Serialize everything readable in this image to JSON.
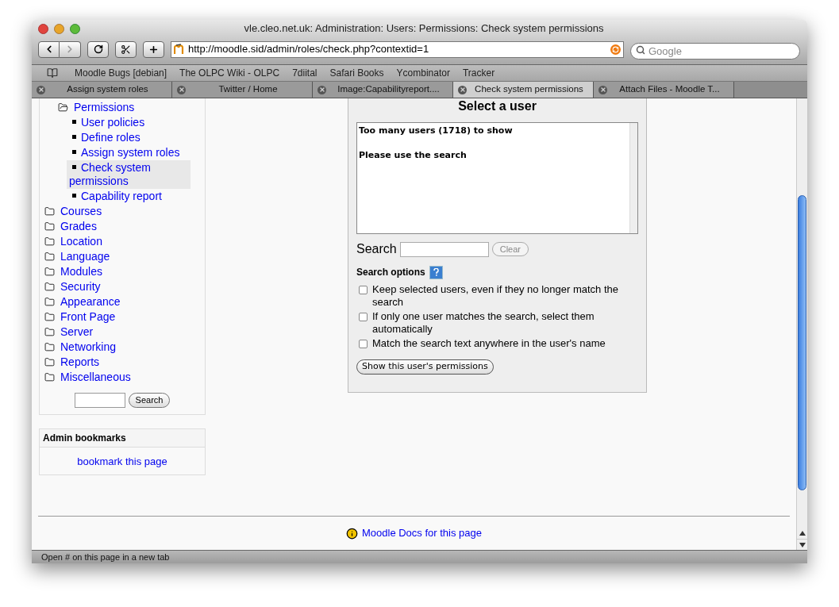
{
  "window": {
    "title": "vle.cleo.net.uk: Administration: Users: Permissions: Check system permissions"
  },
  "toolbar": {
    "url": "http://moodle.sid/admin/roles/check.php?contextid=1",
    "search_placeholder": "Google"
  },
  "bookmarks": [
    "Moodle Bugs [debian]",
    "The OLPC Wiki - OLPC",
    "7diital",
    "Safari Books",
    "Ycombinator",
    "Tracker"
  ],
  "tabs": [
    {
      "label": "Assign system roles",
      "selected": false
    },
    {
      "label": "Twitter / Home",
      "selected": false
    },
    {
      "label": "Image:Capabilityreport....",
      "selected": false
    },
    {
      "label": "Check system permissions",
      "selected": true
    },
    {
      "label": "Attach Files - Moodle T...",
      "selected": false
    }
  ],
  "sidebar": {
    "tree": [
      {
        "label": "Permissions",
        "expanded": true,
        "children": [
          {
            "label": "User policies",
            "selected": false
          },
          {
            "label": "Define roles",
            "selected": false
          },
          {
            "label": "Assign system roles",
            "selected": false
          },
          {
            "label": "Check system permissions",
            "selected": true
          },
          {
            "label": "Capability report",
            "selected": false
          }
        ]
      },
      {
        "label": "Courses",
        "expanded": false
      },
      {
        "label": "Grades",
        "expanded": false
      },
      {
        "label": "Location",
        "expanded": false
      },
      {
        "label": "Language",
        "expanded": false
      },
      {
        "label": "Modules",
        "expanded": false
      },
      {
        "label": "Security",
        "expanded": false
      },
      {
        "label": "Appearance",
        "expanded": false
      },
      {
        "label": "Front Page",
        "expanded": false
      },
      {
        "label": "Server",
        "expanded": false
      },
      {
        "label": "Networking",
        "expanded": false
      },
      {
        "label": "Reports",
        "expanded": false
      },
      {
        "label": "Miscellaneous",
        "expanded": false
      }
    ],
    "search_button": "Search",
    "bookmarks_block": {
      "title": "Admin bookmarks",
      "link": "bookmark this page"
    }
  },
  "panel": {
    "heading": "Select a user",
    "list_lines": [
      "Too many users (1718) to show",
      "Please use the search"
    ],
    "search_label": "Search",
    "clear_button": "Clear",
    "options_label": "Search options",
    "options": [
      {
        "label": "Keep selected users, even if they no longer match the search",
        "checked": false
      },
      {
        "label": "If only one user matches the search, select them automatically",
        "checked": false
      },
      {
        "label": "Match the search text anywhere in the user's name",
        "checked": false
      }
    ],
    "submit_button": "Show this user's permissions"
  },
  "footer": {
    "docs_link": "Moodle Docs for this page"
  },
  "status_bar": "Open # on this page in a new tab"
}
